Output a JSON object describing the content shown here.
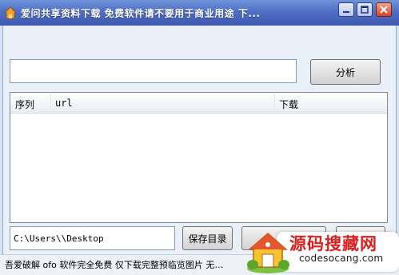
{
  "window": {
    "title": "爱问共享资料下载 免费软件请不要用于商业用途 下...",
    "buttons": {
      "minimize": "min-icon",
      "maximize": "max-icon",
      "close": "close-icon"
    }
  },
  "url_input": {
    "value": ""
  },
  "analyze_button": {
    "label": "分析"
  },
  "list": {
    "columns": {
      "index": "序列",
      "url": "url",
      "download": "下载"
    },
    "rows": []
  },
  "save": {
    "path_value": "C:\\Users\\\\Desktop",
    "button_label": "保存目录"
  },
  "status": {
    "text": "吾爱破解 ofo 软件完全免费 仅下载完整预临览图片 无…"
  },
  "watermark": {
    "cn": "源码搜藏网",
    "en": "codesocang.com"
  },
  "colors": {
    "titlebar": "#4f6fc4",
    "accent_red": "#d8201f"
  }
}
